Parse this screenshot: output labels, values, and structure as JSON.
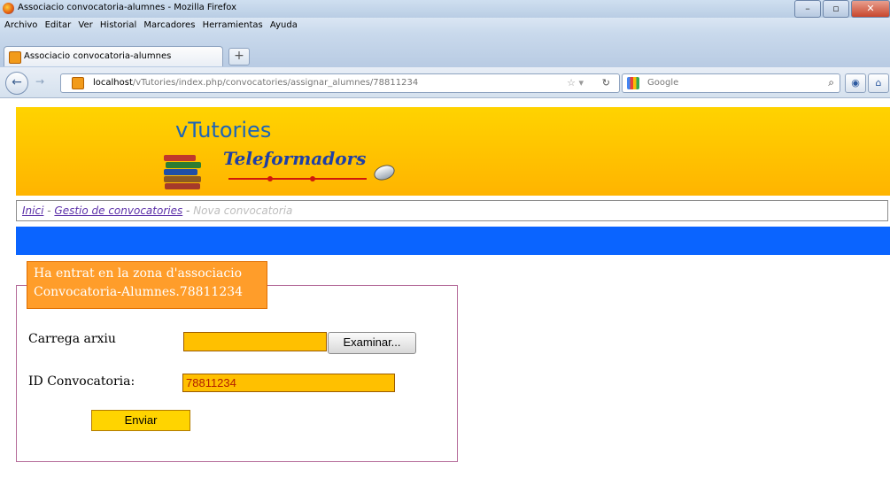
{
  "window": {
    "title": "Associacio convocatoria-alumnes - Mozilla Firefox"
  },
  "menubar": {
    "items": [
      "Archivo",
      "Editar",
      "Ver",
      "Historial",
      "Marcadores",
      "Herramientas",
      "Ayuda"
    ]
  },
  "tab": {
    "label": "Associacio convocatoria-alumnes"
  },
  "address_bar": {
    "host": "localhost",
    "path": "/vTutories/index.php/convocatories/assignar_alumnes/78811234"
  },
  "search_bar": {
    "engine": "Google"
  },
  "header": {
    "brand": "vTutories",
    "subtitle": "Teleformadors"
  },
  "breadcrumb": {
    "home": "Inici",
    "sep1": " - ",
    "manage": "Gestio de convocatories",
    "sep2": " - ",
    "current": "Nova convocatoria"
  },
  "form": {
    "legend": "Ha entrat en la zona d'associacio Convocatoria-Alumnes.78811234",
    "file_label": "Carrega arxiu",
    "browse_label": "Examinar...",
    "id_label": "ID Convocatoria:",
    "id_value": "78811234",
    "send_label": "Enviar"
  },
  "colors": {
    "banner": "#ffc400",
    "bluebar": "#0a64ff",
    "legend": "#ff9d2a",
    "field": "#ffc000"
  }
}
